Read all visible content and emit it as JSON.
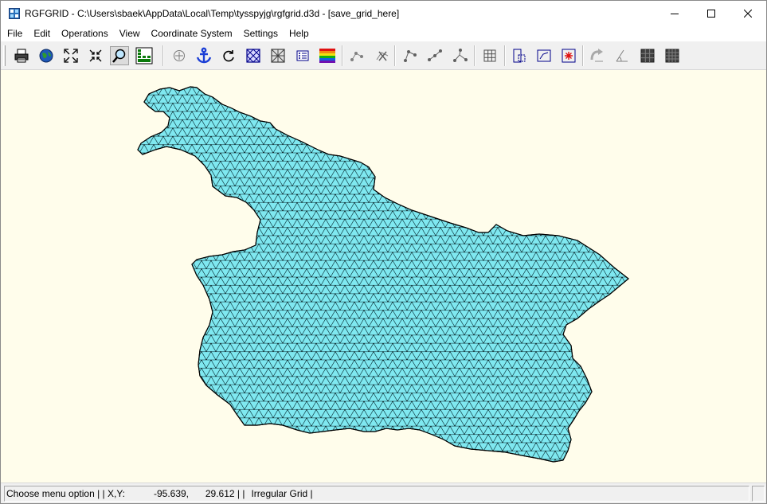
{
  "window": {
    "title": "RGFGRID - C:\\Users\\sbaek\\AppData\\Local\\Temp\\tysspyjg\\rgfgrid.d3d - [save_grid_here]"
  },
  "menu": [
    {
      "label": "File"
    },
    {
      "label": "Edit"
    },
    {
      "label": "Operations"
    },
    {
      "label": "View"
    },
    {
      "label": "Coordinate System"
    },
    {
      "label": "Settings"
    },
    {
      "label": "Help"
    }
  ],
  "toolbar": {
    "icons": [
      "print-icon",
      "globe-icon",
      "zoom-extents-icon",
      "zoom-shrink-icon",
      "zoom-box-icon",
      "colorscale-icon",
      "snap-circle-icon",
      "anchor-icon",
      "refresh-icon",
      "grid-pattern-icon",
      "grid-pattern-2-icon",
      "list-icon",
      "rainbow-icon",
      "spline-point-icon",
      "delete-spline-icon",
      "spline-insert-icon",
      "spline-move-icon",
      "spline-delete-point-icon",
      "grid-refine-icon",
      "grid-select-icon",
      "grid-frame-icon",
      "grid-star-icon",
      "orthogonalize-icon",
      "angle-icon",
      "grid-dark-icon",
      "grid-dark-2-icon"
    ]
  },
  "canvas": {
    "background": "#fffdeb",
    "mesh_fill": "#7fe8f0",
    "mesh_line": "#000000"
  },
  "status": {
    "message": "Choose menu option |",
    "sep1": " | X,Y:",
    "x": "-95.639,",
    "y": "29.612 |",
    "sep2": " |",
    "grid_type": "Irregular Grid |"
  }
}
